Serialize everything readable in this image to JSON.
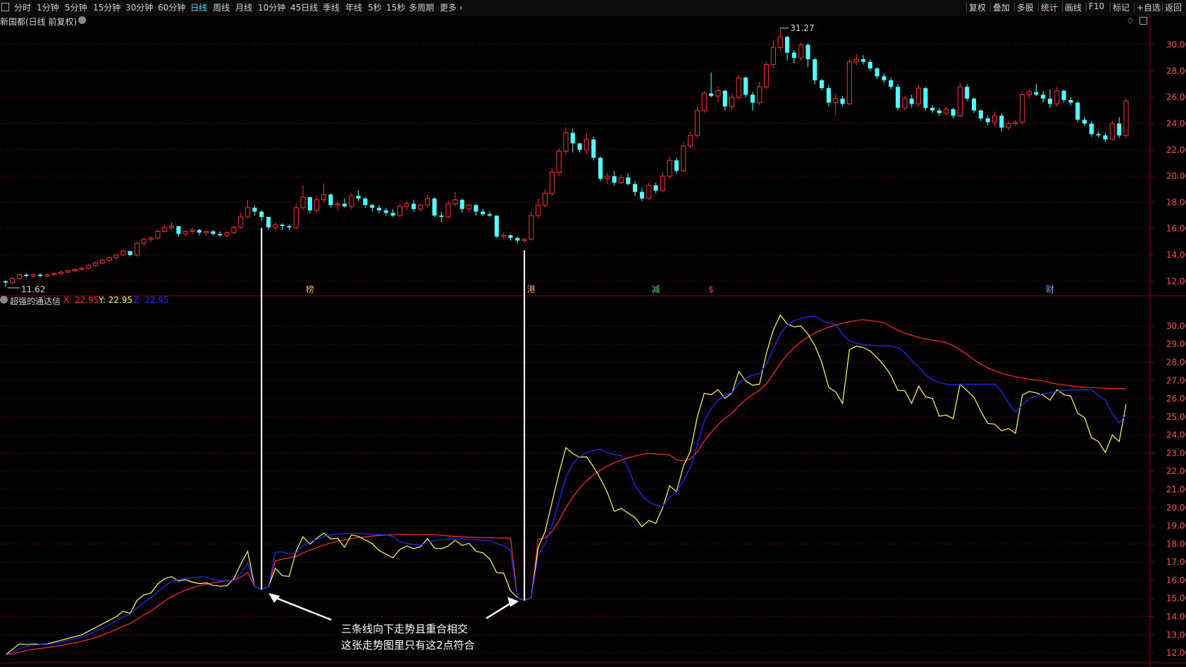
{
  "toolbar": {
    "periods": [
      "分时",
      "1分钟",
      "5分钟",
      "15分钟",
      "30分钟",
      "60分钟",
      "日线",
      "周线",
      "月线",
      "10分钟",
      "45日线",
      "季线",
      "年线",
      "5秒",
      "15秒",
      "多周期",
      "更多"
    ],
    "active_period": "日线",
    "actions": [
      "复权",
      "叠加",
      "多股",
      "统计",
      "画线",
      "F10",
      "标记",
      "+自选",
      "返回"
    ]
  },
  "main_panel": {
    "title": "新国都(日线 前复权)",
    "price_axis": [
      "30.00",
      "28.00",
      "26.00",
      "24.00",
      "22.00",
      "20.00",
      "18.00",
      "16.00",
      "14.00",
      "12.00"
    ],
    "high_label": "31.27",
    "low_label": "11.62",
    "event_markers": [
      {
        "text": "榜",
        "color": "#e8b060"
      },
      {
        "text": "港",
        "color": "#e8b060"
      },
      {
        "text": "减",
        "color": "#5fd35f"
      },
      {
        "text": "$",
        "color": "#ff4040"
      },
      {
        "text": "财",
        "color": "#6aa8ff"
      }
    ]
  },
  "indicator_panel": {
    "name": "超强的通达信",
    "x_label": "X: 22.95",
    "y_label": "Y: 22.95",
    "z_label": "Z: 22.95",
    "colors": {
      "x": "#ff3030",
      "y": "#ffff66",
      "z": "#2030ff"
    },
    "axis": [
      "30.00",
      "29.00",
      "28.00",
      "27.00",
      "26.00",
      "25.00",
      "24.00",
      "23.00",
      "22.00",
      "21.00",
      "20.00",
      "19.00",
      "18.00",
      "17.00",
      "16.00",
      "15.00",
      "14.00",
      "13.00",
      "12.00"
    ]
  },
  "annotation": {
    "line1": "三条线向下走势且重合相交",
    "line2": "这张走势图里只有这2点符合"
  },
  "candles": [
    [
      12.0,
      12.1,
      11.6,
      11.9
    ],
    [
      11.9,
      12.3,
      11.8,
      12.2
    ],
    [
      12.2,
      12.6,
      12.1,
      12.5
    ],
    [
      12.5,
      12.6,
      12.3,
      12.4
    ],
    [
      12.4,
      12.6,
      12.3,
      12.5
    ],
    [
      12.5,
      12.6,
      12.3,
      12.4
    ],
    [
      12.4,
      12.6,
      12.3,
      12.5
    ],
    [
      12.5,
      12.7,
      12.4,
      12.6
    ],
    [
      12.6,
      12.8,
      12.5,
      12.7
    ],
    [
      12.7,
      12.9,
      12.6,
      12.8
    ],
    [
      12.8,
      13.0,
      12.7,
      12.9
    ],
    [
      12.9,
      13.1,
      12.8,
      13.0
    ],
    [
      13.0,
      13.3,
      12.9,
      13.2
    ],
    [
      13.2,
      13.5,
      13.1,
      13.4
    ],
    [
      13.4,
      13.7,
      13.3,
      13.6
    ],
    [
      13.6,
      13.9,
      13.5,
      13.8
    ],
    [
      13.8,
      14.1,
      13.6,
      14.0
    ],
    [
      14.0,
      14.4,
      13.9,
      14.3
    ],
    [
      14.3,
      14.2,
      13.9,
      14.0
    ],
    [
      14.0,
      15.0,
      13.9,
      14.9
    ],
    [
      14.9,
      15.3,
      14.7,
      15.2
    ],
    [
      15.2,
      15.4,
      15.0,
      15.3
    ],
    [
      15.3,
      15.9,
      15.2,
      15.8
    ],
    [
      15.8,
      16.3,
      15.7,
      16.1
    ],
    [
      16.1,
      16.5,
      15.9,
      16.2
    ],
    [
      16.2,
      16.1,
      15.4,
      15.6
    ],
    [
      15.6,
      15.9,
      15.4,
      15.8
    ],
    [
      15.8,
      16.1,
      15.6,
      15.9
    ],
    [
      15.9,
      16.0,
      15.5,
      15.7
    ],
    [
      15.7,
      15.9,
      15.5,
      15.8
    ],
    [
      15.8,
      15.9,
      15.5,
      15.6
    ],
    [
      15.6,
      15.8,
      15.4,
      15.5
    ],
    [
      15.5,
      15.8,
      15.3,
      15.7
    ],
    [
      15.7,
      16.2,
      15.6,
      16.1
    ],
    [
      16.1,
      17.2,
      16.0,
      16.9
    ],
    [
      16.9,
      18.2,
      16.8,
      17.6
    ],
    [
      17.6,
      17.8,
      17.0,
      17.3
    ],
    [
      17.3,
      17.4,
      16.6,
      16.9
    ],
    [
      16.9,
      16.7,
      15.9,
      16.1
    ],
    [
      16.1,
      16.5,
      15.9,
      16.3
    ],
    [
      16.3,
      16.4,
      15.9,
      16.2
    ],
    [
      16.2,
      16.3,
      15.9,
      16.1
    ],
    [
      16.1,
      17.9,
      16.0,
      17.6
    ],
    [
      17.6,
      19.3,
      17.4,
      18.4
    ],
    [
      18.4,
      18.3,
      17.2,
      17.4
    ],
    [
      17.4,
      18.5,
      17.2,
      18.2
    ],
    [
      18.2,
      19.4,
      18.0,
      18.6
    ],
    [
      18.6,
      18.7,
      17.6,
      17.8
    ],
    [
      17.8,
      18.1,
      17.4,
      17.9
    ],
    [
      17.9,
      18.3,
      17.6,
      17.7
    ],
    [
      17.7,
      18.7,
      17.5,
      18.5
    ],
    [
      18.5,
      18.9,
      18.1,
      18.3
    ],
    [
      18.3,
      18.4,
      17.6,
      17.8
    ],
    [
      17.8,
      17.9,
      17.3,
      17.6
    ],
    [
      17.6,
      17.8,
      17.2,
      17.4
    ],
    [
      17.4,
      17.6,
      17.0,
      17.2
    ],
    [
      17.2,
      17.5,
      16.9,
      17.0
    ],
    [
      17.0,
      17.9,
      16.9,
      17.7
    ],
    [
      17.7,
      18.1,
      17.4,
      17.9
    ],
    [
      17.9,
      18.2,
      17.3,
      17.5
    ],
    [
      17.5,
      17.9,
      17.3,
      17.8
    ],
    [
      17.8,
      18.6,
      17.6,
      18.3
    ],
    [
      18.3,
      18.4,
      16.9,
      17.0
    ],
    [
      17.0,
      17.3,
      16.5,
      16.9
    ],
    [
      16.9,
      18.1,
      16.8,
      17.9
    ],
    [
      17.9,
      18.8,
      17.7,
      18.2
    ],
    [
      18.2,
      18.3,
      17.2,
      17.5
    ],
    [
      17.5,
      17.9,
      17.3,
      17.8
    ],
    [
      17.8,
      17.9,
      17.0,
      17.3
    ],
    [
      17.3,
      17.5,
      17.0,
      17.1
    ],
    [
      17.1,
      17.3,
      16.9,
      17.0
    ],
    [
      17.0,
      16.9,
      15.3,
      15.4
    ],
    [
      15.4,
      15.7,
      15.2,
      15.5
    ],
    [
      15.5,
      15.6,
      15.1,
      15.3
    ],
    [
      15.3,
      15.4,
      14.9,
      15.1
    ],
    [
      15.1,
      15.3,
      14.9,
      15.2
    ],
    [
      15.2,
      17.3,
      15.1,
      17.0
    ],
    [
      17.0,
      18.3,
      16.8,
      17.8
    ],
    [
      17.8,
      19.0,
      17.6,
      18.7
    ],
    [
      18.7,
      20.6,
      18.5,
      20.3
    ],
    [
      20.3,
      22.1,
      20.0,
      21.9
    ],
    [
      21.9,
      23.7,
      21.6,
      23.3
    ],
    [
      23.3,
      23.6,
      21.8,
      22.5
    ],
    [
      22.5,
      22.4,
      21.8,
      22.0
    ],
    [
      22.0,
      23.3,
      21.7,
      22.8
    ],
    [
      22.8,
      23.0,
      21.2,
      21.4
    ],
    [
      21.4,
      21.5,
      19.6,
      19.8
    ],
    [
      19.8,
      20.3,
      19.4,
      20.0
    ],
    [
      20.0,
      20.4,
      19.3,
      19.5
    ],
    [
      19.5,
      20.1,
      19.4,
      19.9
    ],
    [
      19.9,
      20.2,
      19.3,
      19.4
    ],
    [
      19.4,
      19.6,
      18.5,
      18.8
    ],
    [
      18.8,
      19.1,
      18.1,
      18.3
    ],
    [
      18.3,
      19.5,
      18.2,
      19.3
    ],
    [
      19.3,
      19.5,
      18.7,
      18.9
    ],
    [
      18.9,
      20.3,
      18.8,
      20.0
    ],
    [
      20.0,
      21.5,
      19.8,
      21.2
    ],
    [
      21.2,
      21.4,
      20.2,
      20.4
    ],
    [
      20.4,
      22.6,
      20.3,
      22.3
    ],
    [
      22.3,
      23.4,
      22.1,
      23.1
    ],
    [
      23.1,
      25.3,
      22.9,
      25.0
    ],
    [
      25.0,
      26.5,
      24.8,
      26.3
    ],
    [
      26.3,
      27.9,
      26.0,
      26.1
    ],
    [
      26.1,
      26.8,
      25.6,
      26.5
    ],
    [
      26.5,
      26.6,
      25.0,
      25.3
    ],
    [
      25.3,
      26.3,
      25.1,
      26.0
    ],
    [
      26.0,
      27.7,
      25.8,
      27.5
    ],
    [
      27.5,
      27.6,
      26.0,
      26.2
    ],
    [
      26.2,
      26.4,
      25.0,
      25.6
    ],
    [
      25.6,
      27.2,
      25.4,
      26.8
    ],
    [
      26.8,
      28.7,
      26.6,
      28.5
    ],
    [
      28.5,
      30.3,
      28.2,
      29.8
    ],
    [
      29.8,
      31.27,
      29.5,
      30.6
    ],
    [
      30.6,
      30.7,
      28.8,
      29.4
    ],
    [
      29.4,
      29.6,
      28.6,
      29.0
    ],
    [
      29.0,
      30.2,
      28.8,
      30.0
    ],
    [
      30.0,
      30.1,
      28.3,
      28.9
    ],
    [
      28.9,
      29.0,
      27.0,
      27.3
    ],
    [
      27.3,
      27.4,
      26.5,
      26.7
    ],
    [
      26.7,
      26.9,
      25.3,
      25.6
    ],
    [
      25.6,
      26.3,
      24.6,
      25.9
    ],
    [
      25.9,
      26.1,
      25.3,
      25.5
    ],
    [
      25.5,
      28.9,
      25.4,
      28.7
    ],
    [
      28.7,
      29.3,
      28.4,
      28.9
    ],
    [
      28.9,
      29.2,
      28.5,
      28.7
    ],
    [
      28.7,
      28.9,
      28.0,
      28.2
    ],
    [
      28.2,
      28.3,
      27.4,
      27.6
    ],
    [
      27.6,
      27.8,
      27.1,
      27.3
    ],
    [
      27.3,
      27.5,
      26.6,
      26.8
    ],
    [
      26.8,
      27.0,
      25.0,
      25.2
    ],
    [
      25.2,
      26.1,
      25.0,
      25.9
    ],
    [
      25.9,
      26.2,
      25.2,
      25.5
    ],
    [
      25.5,
      26.9,
      25.3,
      26.7
    ],
    [
      26.7,
      26.8,
      25.0,
      25.2
    ],
    [
      25.2,
      25.4,
      24.8,
      25.0
    ],
    [
      25.0,
      25.2,
      24.6,
      24.8
    ],
    [
      24.8,
      25.3,
      24.6,
      25.1
    ],
    [
      25.1,
      25.2,
      24.4,
      24.6
    ],
    [
      24.6,
      27.1,
      24.5,
      26.8
    ],
    [
      26.8,
      27.0,
      25.7,
      25.9
    ],
    [
      25.9,
      26.0,
      24.8,
      25.0
    ],
    [
      25.0,
      25.1,
      24.2,
      24.4
    ],
    [
      24.4,
      24.6,
      23.9,
      24.1
    ],
    [
      24.1,
      24.9,
      23.8,
      24.6
    ],
    [
      24.6,
      24.8,
      23.4,
      23.7
    ],
    [
      23.7,
      24.2,
      23.5,
      24.0
    ],
    [
      24.0,
      24.3,
      23.8,
      24.1
    ],
    [
      24.1,
      26.4,
      23.9,
      26.2
    ],
    [
      26.2,
      26.6,
      25.9,
      26.4
    ],
    [
      26.4,
      27.0,
      26.1,
      26.2
    ],
    [
      26.2,
      26.5,
      25.6,
      25.9
    ],
    [
      25.9,
      26.6,
      25.2,
      25.5
    ],
    [
      25.5,
      26.8,
      25.3,
      26.5
    ],
    [
      26.5,
      26.6,
      25.6,
      25.8
    ],
    [
      25.8,
      26.0,
      25.4,
      25.6
    ],
    [
      25.6,
      25.7,
      24.1,
      24.3
    ],
    [
      24.3,
      24.5,
      23.8,
      24.0
    ],
    [
      24.0,
      24.2,
      23.0,
      23.2
    ],
    [
      23.2,
      23.4,
      22.9,
      23.1
    ],
    [
      23.1,
      23.3,
      22.6,
      22.8
    ],
    [
      22.8,
      24.2,
      22.7,
      24.0
    ],
    [
      24.0,
      24.5,
      22.9,
      23.1
    ],
    [
      23.1,
      25.9,
      22.9,
      25.7
    ]
  ]
}
